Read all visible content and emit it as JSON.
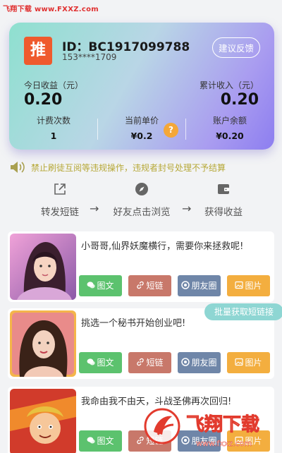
{
  "watermark_top": "飞翔下载 www.FXXZ.com",
  "profile": {
    "badge": "推",
    "id_label": "ID：BC1917099788",
    "phone": "153****1709",
    "feedback_button": "建议反馈",
    "today_label": "今日收益（元）",
    "today_value": "0.20",
    "total_label": "累计收入（元）",
    "total_value": "0.20",
    "count_label": "计费次数",
    "count_value": "1",
    "unit_price_label": "当前单价",
    "unit_price_value": "¥0.2",
    "help_mark": "?",
    "balance_label": "账户余额",
    "balance_value": "¥0.20"
  },
  "notice": "禁止刷徒互阅等违规操作，违规者封号处理不予结算",
  "steps": [
    {
      "label": "转发短链",
      "icon": "share-out-icon"
    },
    {
      "label": "好友点击浏览",
      "icon": "compass-icon"
    },
    {
      "label": "获得收益",
      "icon": "wallet-icon"
    }
  ],
  "step_arrow": "→",
  "batch_button": "批量获取短链接",
  "actions": [
    {
      "label": "图文",
      "icon": "wechat-icon",
      "color": "#5cc26e"
    },
    {
      "label": "短链",
      "icon": "link-icon",
      "color": "#c8786a"
    },
    {
      "label": "朋友圈",
      "icon": "moments-icon",
      "color": "#6f86a8"
    },
    {
      "label": "图片",
      "icon": "image-icon",
      "color": "#f3ae3f"
    }
  ],
  "items": [
    {
      "title": "小哥哥,仙界妖魔横行，需要你来拯救呢!"
    },
    {
      "title": "挑选一个秘书开始创业吧!"
    },
    {
      "title": "我命由我不由天，斗战圣佛再次回归!"
    }
  ],
  "watermark_bottom": {
    "brand": "飞翔下载",
    "url": "www.fxxz.com"
  },
  "colors": {
    "accent": "#ef5a2d",
    "notice": "#b6a838",
    "help": "#f4a738"
  }
}
